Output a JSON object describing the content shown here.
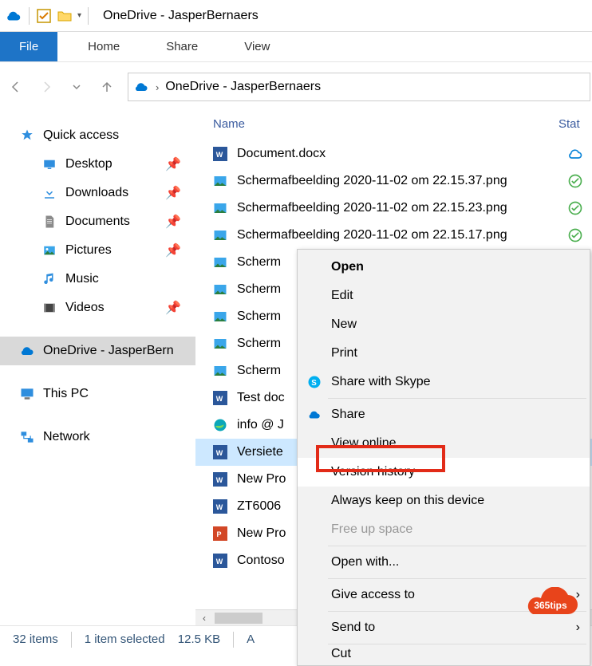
{
  "window": {
    "title": "OneDrive - JasperBernaers"
  },
  "tabs": {
    "file": "File",
    "home": "Home",
    "share": "Share",
    "view": "View"
  },
  "breadcrumb": {
    "root": "OneDrive - JasperBernaers"
  },
  "sidebar": {
    "quick_access": "Quick access",
    "desktop": "Desktop",
    "downloads": "Downloads",
    "documents": "Documents",
    "pictures": "Pictures",
    "music": "Music",
    "videos": "Videos",
    "onedrive": "OneDrive - JasperBern",
    "this_pc": "This PC",
    "network": "Network"
  },
  "columns": {
    "name": "Name",
    "status": "Stat"
  },
  "files": {
    "f0": "Document.docx",
    "f1": "Schermafbeelding 2020-11-02 om 22.15.37.png",
    "f2": "Schermafbeelding 2020-11-02 om 22.15.23.png",
    "f3": "Schermafbeelding 2020-11-02 om 22.15.17.png",
    "f4": "Scherm",
    "f5": "Scherm",
    "f6": "Scherm",
    "f7": "Scherm",
    "f8": "Scherm",
    "f9": "Test doc",
    "f10": "info @ J",
    "f11": "Versiete",
    "f12": "New Pro",
    "f13": "ZT6006",
    "f14": "New Pro",
    "f15": "Contoso"
  },
  "contextmenu": {
    "open": "Open",
    "edit": "Edit",
    "new": "New",
    "print": "Print",
    "share_skype": "Share with Skype",
    "share": "Share",
    "view_online": "View online",
    "version_history": "Version history",
    "always_keep": "Always keep on this device",
    "free_up": "Free up space",
    "open_with": "Open with...",
    "give_access": "Give access to",
    "send_to": "Send to",
    "cut": "Cut"
  },
  "statusbar": {
    "items": "32 items",
    "selected": "1 item selected",
    "size": "12.5 KB",
    "available": "A"
  },
  "badge": {
    "label": "365tips"
  }
}
